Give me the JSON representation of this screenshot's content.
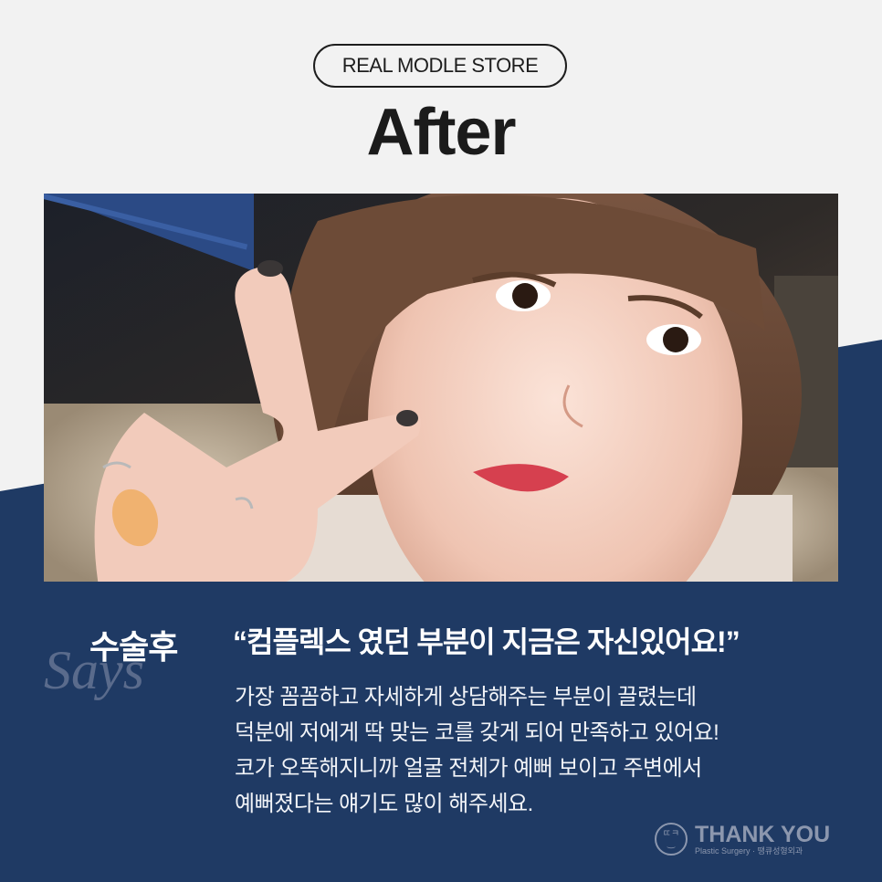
{
  "header": {
    "store_label": "REAL MODLE STORE",
    "title": "After"
  },
  "photo": {
    "subject": "selfie-v-sign"
  },
  "review": {
    "label": "수술후",
    "says_watermark": "Says",
    "quote": "“컴플렉스 였던 부분이 지금은 자신있어요!”",
    "lines": [
      "가장 꼼꼼하고 자세하게 상담해주는 부분이 끌렸는데",
      "덕분에 저에게 딱 맞는 코를 갖게 되어 만족하고 있어요!",
      "코가 오똑해지니까 얼굴 전체가 예뻐 보이고 주변에서",
      "예뻐졌다는 얘기도 많이 해주세요."
    ]
  },
  "logo": {
    "mark": "ㄸㅋ",
    "brand": "THANK YOU",
    "tagline": "Plastic Surgery · 땡큐성형외과"
  },
  "colors": {
    "background": "#f2f2f2",
    "navy": "#1f3a64",
    "text_dark": "#1b1b1b",
    "text_light": "#ffffff",
    "logo_gray": "#8c97ae"
  }
}
